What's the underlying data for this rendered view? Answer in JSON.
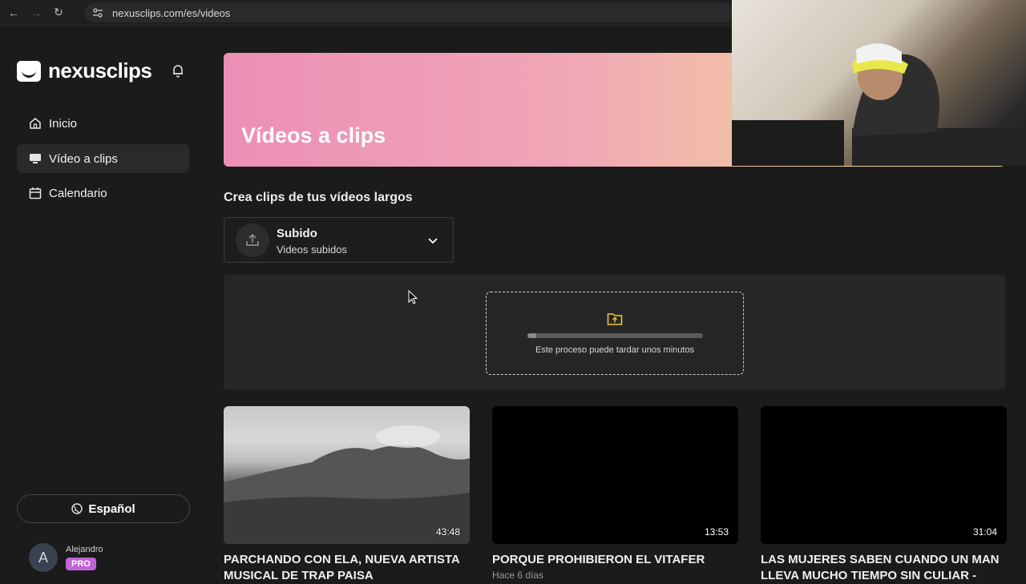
{
  "browser": {
    "url": "nexusclips.com/es/videos"
  },
  "sidebar": {
    "brand": "nexusclips",
    "items": [
      {
        "label": "Inicio",
        "icon": "home-icon"
      },
      {
        "label": "Vídeo a clips",
        "icon": "monitor-icon"
      },
      {
        "label": "Calendario",
        "icon": "calendar-icon"
      }
    ],
    "language_label": "Español",
    "user": {
      "initial": "A",
      "name": "Alejandro",
      "badge": "PRO"
    }
  },
  "main": {
    "hero_title": "Vídeos a clips",
    "section_title": "Crea clips de tus vídeos largos",
    "source": {
      "title": "Subido",
      "subtitle": "Videos subidos"
    },
    "upload": {
      "message": "Este proceso puede tardar unos minutos",
      "progress": 0.05
    },
    "videos": [
      {
        "duration": "43:48",
        "title": "PARCHANDO CON ELA, NUEVA ARTISTA MUSICAL DE TRAP PAISA",
        "meta": ""
      },
      {
        "duration": "13:53",
        "title": "PORQUE PROHIBIERON EL VITAFER",
        "meta": "Hace 6 días"
      },
      {
        "duration": "31:04",
        "title": "LAS MUJERES SABEN CUANDO UN MAN LLEVA MUCHO TIEMPO SIN CULIAR -",
        "meta": ""
      }
    ]
  },
  "colors": {
    "accent_pro": "#c063d8",
    "folder_icon": "#e8c53a"
  }
}
